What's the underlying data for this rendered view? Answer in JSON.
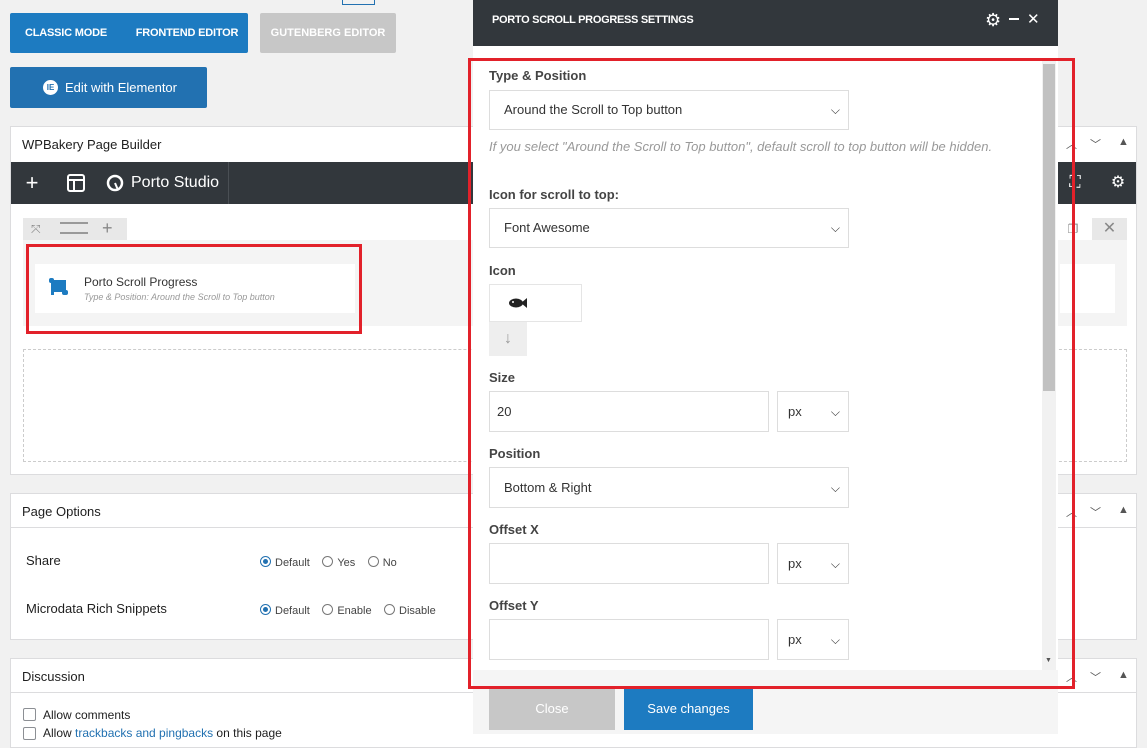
{
  "editor_modes": {
    "classic": "CLASSIC MODE",
    "frontend": "FRONTEND EDITOR",
    "gutenberg": "GUTENBERG EDITOR",
    "elementor": "Edit with Elementor"
  },
  "wpbakery": {
    "title": "WPBakery Page Builder",
    "studio_label": "Porto Studio",
    "element": {
      "name": "Porto Scroll Progress",
      "summary": "Type & Position: Around the Scroll to Top button"
    }
  },
  "page_options": {
    "title": "Page Options",
    "rows": [
      {
        "label": "Share",
        "options": [
          "Default",
          "Yes",
          "No"
        ],
        "selected": "Default"
      },
      {
        "label": "Microdata Rich Snippets",
        "options": [
          "Default",
          "Enable",
          "Disable"
        ],
        "selected": "Default"
      }
    ]
  },
  "discussion": {
    "title": "Discussion",
    "allow_comments": "Allow comments",
    "allow_prefix": "Allow ",
    "trackbacks_link": "trackbacks and pingbacks",
    "allow_suffix": " on this page"
  },
  "modal": {
    "title": "PORTO SCROLL PROGRESS SETTINGS",
    "type_position": {
      "label": "Type & Position",
      "value": "Around the Scroll to Top button",
      "help": "If you select \"Around the Scroll to Top button\", default scroll to top button will be hidden."
    },
    "icon_library": {
      "label": "Icon for scroll to top:",
      "value": "Font Awesome"
    },
    "icon": {
      "label": "Icon"
    },
    "size": {
      "label": "Size",
      "value": "20",
      "unit": "px"
    },
    "position": {
      "label": "Position",
      "value": "Bottom & Right"
    },
    "offset_x": {
      "label": "Offset X",
      "value": "",
      "unit": "px"
    },
    "offset_y": {
      "label": "Offset Y",
      "value": "",
      "unit": "px"
    },
    "close_label": "Close",
    "save_label": "Save changes"
  },
  "colors": {
    "primary_blue": "#1d7bc1",
    "toolbar_dark": "#32373c",
    "highlight_red": "#e2212a",
    "close_grey": "#c7c7c7"
  }
}
